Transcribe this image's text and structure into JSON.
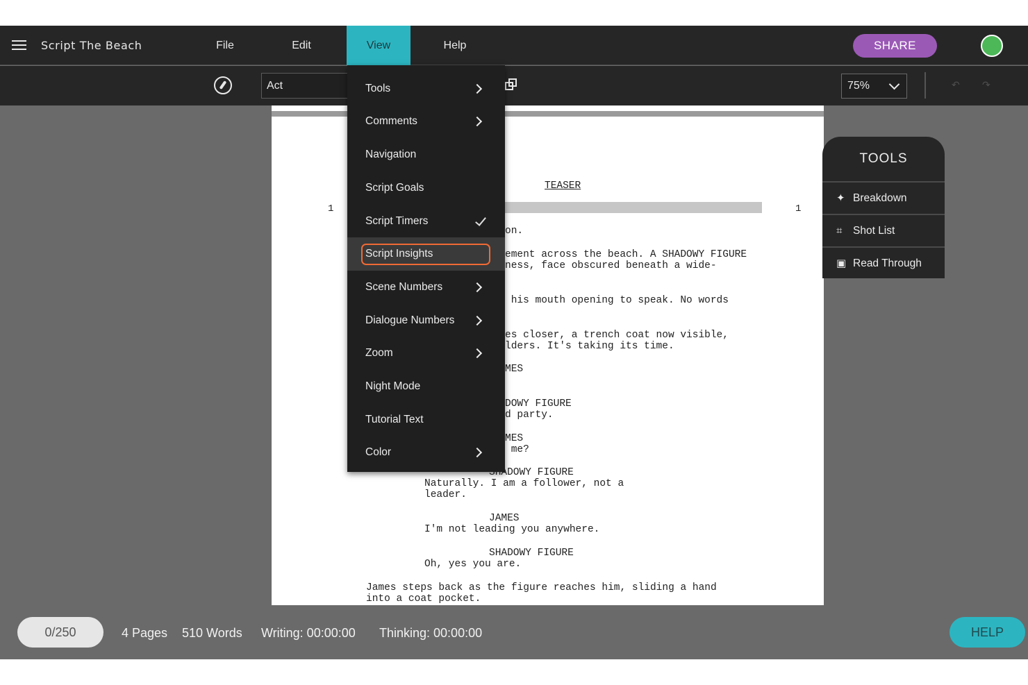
{
  "app": {
    "title": "Script The Beach"
  },
  "menubar": {
    "file": "File",
    "edit": "Edit",
    "view": "View",
    "help": "Help",
    "share": "SHARE"
  },
  "toolbar": {
    "element_type": "Act",
    "zoom": "75%"
  },
  "view_menu": {
    "items": [
      {
        "label": "Tools",
        "submenu": true
      },
      {
        "label": "Comments",
        "submenu": true
      },
      {
        "label": "Navigation"
      },
      {
        "label": "Script Goals"
      },
      {
        "label": "Script Timers",
        "checked": true
      },
      {
        "label": "Script Insights",
        "highlighted": true
      },
      {
        "label": "Scene Numbers",
        "submenu": true
      },
      {
        "label": "Dialogue Numbers",
        "submenu": true
      },
      {
        "label": "Zoom",
        "submenu": true
      },
      {
        "label": "Night Mode"
      },
      {
        "label": "Tutorial Text"
      },
      {
        "label": "Color",
        "submenu": true
      }
    ]
  },
  "script": {
    "heading": "TEASER",
    "scene_number_left": "1",
    "scene_number_right": "1",
    "lines": [
      "on.",
      "ement across the beach. A SHADOWY FIGURE",
      "ness, face obscured beneath a wide-",
      " his mouth opening to speak. No words",
      "es closer, a trench coat now visible,",
      "lders. It's taking its time.",
      "MES",
      "DOWY FIGURE",
      "d party.",
      "MES",
      " me?",
      "SHADOWY FIGURE",
      "Naturally. I am a follower, not a",
      "leader.",
      "JAMES",
      "I'm not leading you anywhere.",
      "SHADOWY FIGURE",
      "Oh, yes you are.",
      "James steps back as the figure reaches him, sliding a hand",
      "into a coat pocket."
    ]
  },
  "tools_panel": {
    "title": "TOOLS",
    "buttons": [
      {
        "label": "Breakdown",
        "icon": "magic-wand-icon"
      },
      {
        "label": "Shot List",
        "icon": "frame-icon"
      },
      {
        "label": "Read Through",
        "icon": "clipboard-icon"
      }
    ]
  },
  "statusbar": {
    "goal": "0/250",
    "pages": "4 Pages",
    "words": "510 Words",
    "writing": "Writing: 00:00:00",
    "thinking": "Thinking: 00:00:00",
    "help": "HELP"
  },
  "colors": {
    "accent_teal": "#2cb5c1",
    "share_purple": "#9b59b6",
    "status_green": "#4cb858",
    "highlight_orange": "#f06a35"
  }
}
